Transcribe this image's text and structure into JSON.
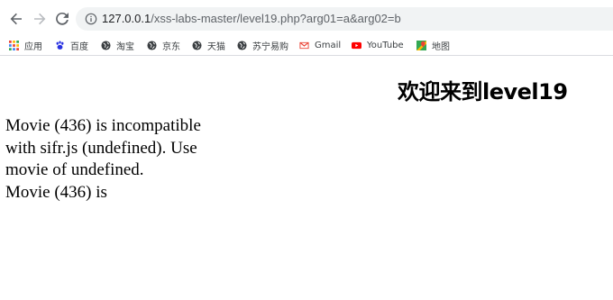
{
  "browser": {
    "url_host": "127.0.0.1",
    "url_path": "/xss-labs-master/level19.php?arg01=a&arg02=b"
  },
  "bookmarks": [
    {
      "label": "应用",
      "icon": "apps-grid-icon",
      "color": "#4285f4"
    },
    {
      "label": "百度",
      "icon": "baidu-paw-icon",
      "color": "#2932e1"
    },
    {
      "label": "淘宝",
      "icon": "globe-icon",
      "color": "#202124"
    },
    {
      "label": "京东",
      "icon": "globe-icon",
      "color": "#202124"
    },
    {
      "label": "天猫",
      "icon": "globe-icon",
      "color": "#202124"
    },
    {
      "label": "苏宁易购",
      "icon": "globe-icon",
      "color": "#202124"
    },
    {
      "label": "Gmail",
      "icon": "gmail-icon",
      "color": "#ea4335"
    },
    {
      "label": "YouTube",
      "icon": "youtube-icon",
      "color": "#ff0000"
    },
    {
      "label": "地图",
      "icon": "maps-pin-icon",
      "color": "#34a853"
    }
  ],
  "page": {
    "heading": "欢迎来到level19",
    "flash_message_1": "Movie (436) is incompatible with sifr.js (undefined). Use movie of undefined.",
    "flash_message_2": "Movie (436) is"
  }
}
